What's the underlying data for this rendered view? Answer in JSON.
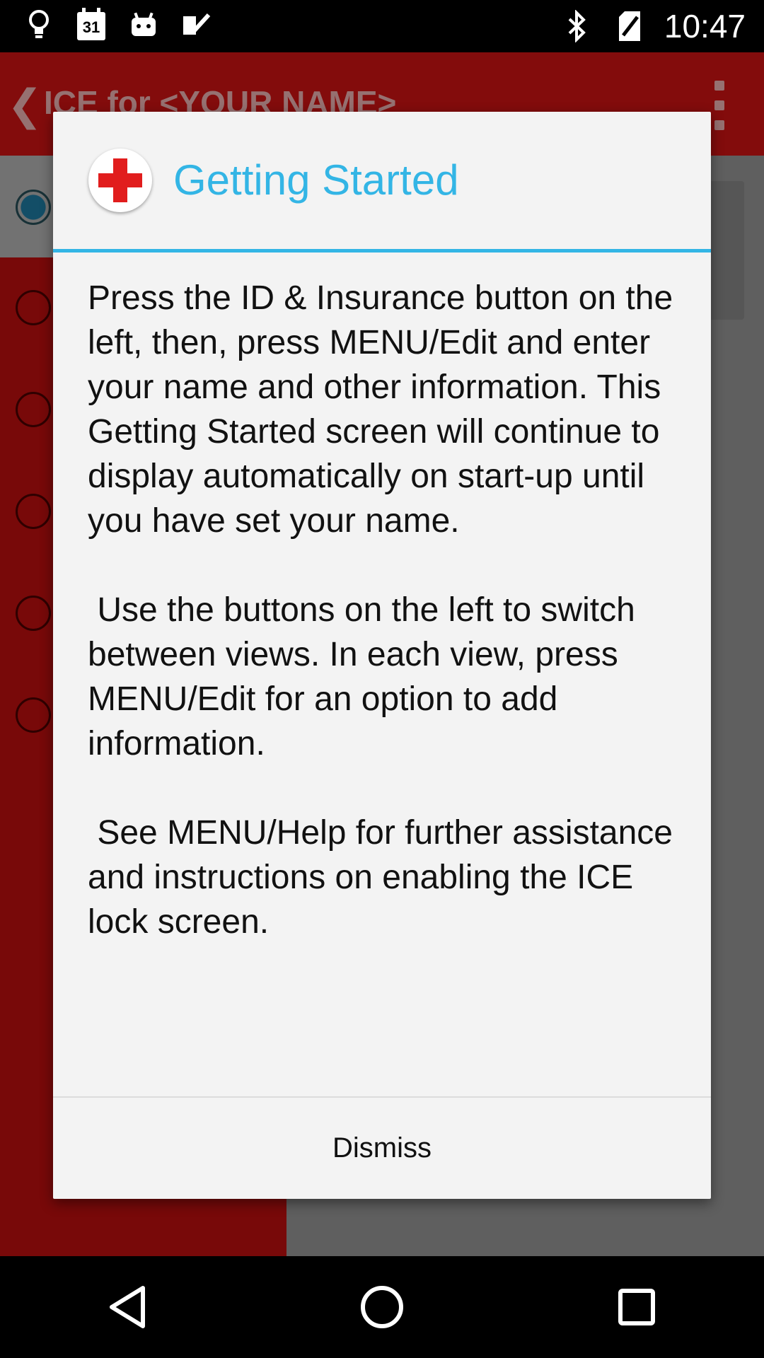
{
  "status_bar": {
    "time": "10:47",
    "calendar_day": "31",
    "icons": [
      "bulb-icon",
      "calendar-icon",
      "android-icon",
      "check-icon",
      "bluetooth-icon",
      "no-sim-icon"
    ]
  },
  "app": {
    "title": "ICE for <YOUR NAME>",
    "accent_color": "#d31414"
  },
  "dialog": {
    "title": "Getting Started",
    "title_color": "#33b5e5",
    "icon": "red-cross-icon",
    "message": "Press the ID & Insurance button on the left, then, press MENU/Edit and enter your name and other information. This Getting Started screen will continue to display automatically on start-up until you have set your name.\n\n Use the buttons on the left to switch between views. In each view, press MENU/Edit for an option to add information.\n\n See MENU/Help for further assistance and instructions on enabling the ICE lock screen.",
    "dismiss_label": "Dismiss"
  },
  "nav_bar": {
    "buttons": [
      "back-icon",
      "home-icon",
      "recents-icon"
    ]
  }
}
